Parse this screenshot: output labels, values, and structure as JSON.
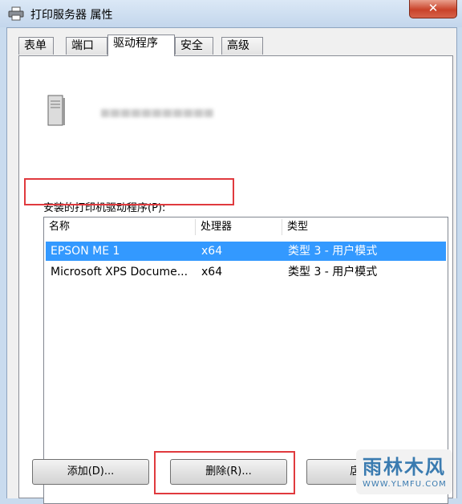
{
  "window": {
    "title": "打印服务器 属性",
    "close_label": "✕",
    "colors": {
      "selection": "#3399ff",
      "highlight_box": "#e03a3e",
      "watermark": "#3a7bb0"
    }
  },
  "tabs": [
    {
      "label": "表单"
    },
    {
      "label": "端口"
    },
    {
      "label": "驱动程序",
      "active": true
    },
    {
      "label": "安全"
    },
    {
      "label": "高级"
    }
  ],
  "drivers": {
    "list_label": "安装的打印机驱动程序(P):",
    "columns": [
      "名称",
      "处理器",
      "类型"
    ],
    "rows": [
      {
        "name": "EPSON ME 1",
        "processor": "x64",
        "type": "类型 3 - 用户模式",
        "selected": true
      },
      {
        "name": "Microsoft XPS Docume...",
        "processor": "x64",
        "type": "类型 3 - 用户模式",
        "selected": false
      }
    ]
  },
  "buttons": {
    "add": "添加(D)...",
    "remove": "删除(R)...",
    "third_partial": "扂"
  },
  "watermark": {
    "text": "雨林木风",
    "url": "WWW.YLMFU.COM"
  }
}
